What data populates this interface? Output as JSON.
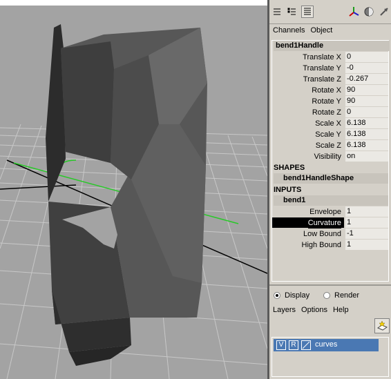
{
  "panel": {
    "tabs": {
      "channels": "Channels",
      "object": "Object"
    },
    "object_name": "bend1Handle",
    "attributes": [
      {
        "name": "Translate X",
        "value": "0"
      },
      {
        "name": "Translate Y",
        "value": "-0"
      },
      {
        "name": "Translate Z",
        "value": "-0.267"
      },
      {
        "name": "Rotate X",
        "value": "90"
      },
      {
        "name": "Rotate Y",
        "value": "90"
      },
      {
        "name": "Rotate Z",
        "value": "0"
      },
      {
        "name": "Scale X",
        "value": "6.138"
      },
      {
        "name": "Scale Y",
        "value": "6.138"
      },
      {
        "name": "Scale Z",
        "value": "6.138"
      },
      {
        "name": "Visibility",
        "value": "on"
      }
    ],
    "shapes_header": "SHAPES",
    "shape_name": "bend1HandleShape",
    "inputs_header": "INPUTS",
    "input_name": "bend1",
    "input_attributes": [
      {
        "name": "Envelope",
        "value": "1"
      },
      {
        "name": "Curvature",
        "value": "1",
        "selected": true
      },
      {
        "name": "Low Bound",
        "value": "-1"
      },
      {
        "name": "High Bound",
        "value": "1"
      }
    ]
  },
  "layer_editor": {
    "display_label": "Display",
    "render_label": "Render",
    "display_selected": true,
    "menu": {
      "layers": "Layers",
      "options": "Options",
      "help": "Help"
    },
    "layers": [
      {
        "v": "V",
        "r": "R",
        "name": "curves"
      }
    ]
  },
  "colors": {
    "viewport_bg": "#a3a3a3",
    "grid": "#c9c9c9",
    "axis_green": "#27c927",
    "mesh_dark": "#3c3c3c",
    "layer_highlight": "#4a78b3"
  },
  "icons": [
    "channel-box-icon",
    "attribute-editor-icon",
    "layer-list-icon",
    "axis-manipulator-icon",
    "shading-sphere-icon",
    "arrow-tool-icon",
    "new-layer-icon"
  ]
}
